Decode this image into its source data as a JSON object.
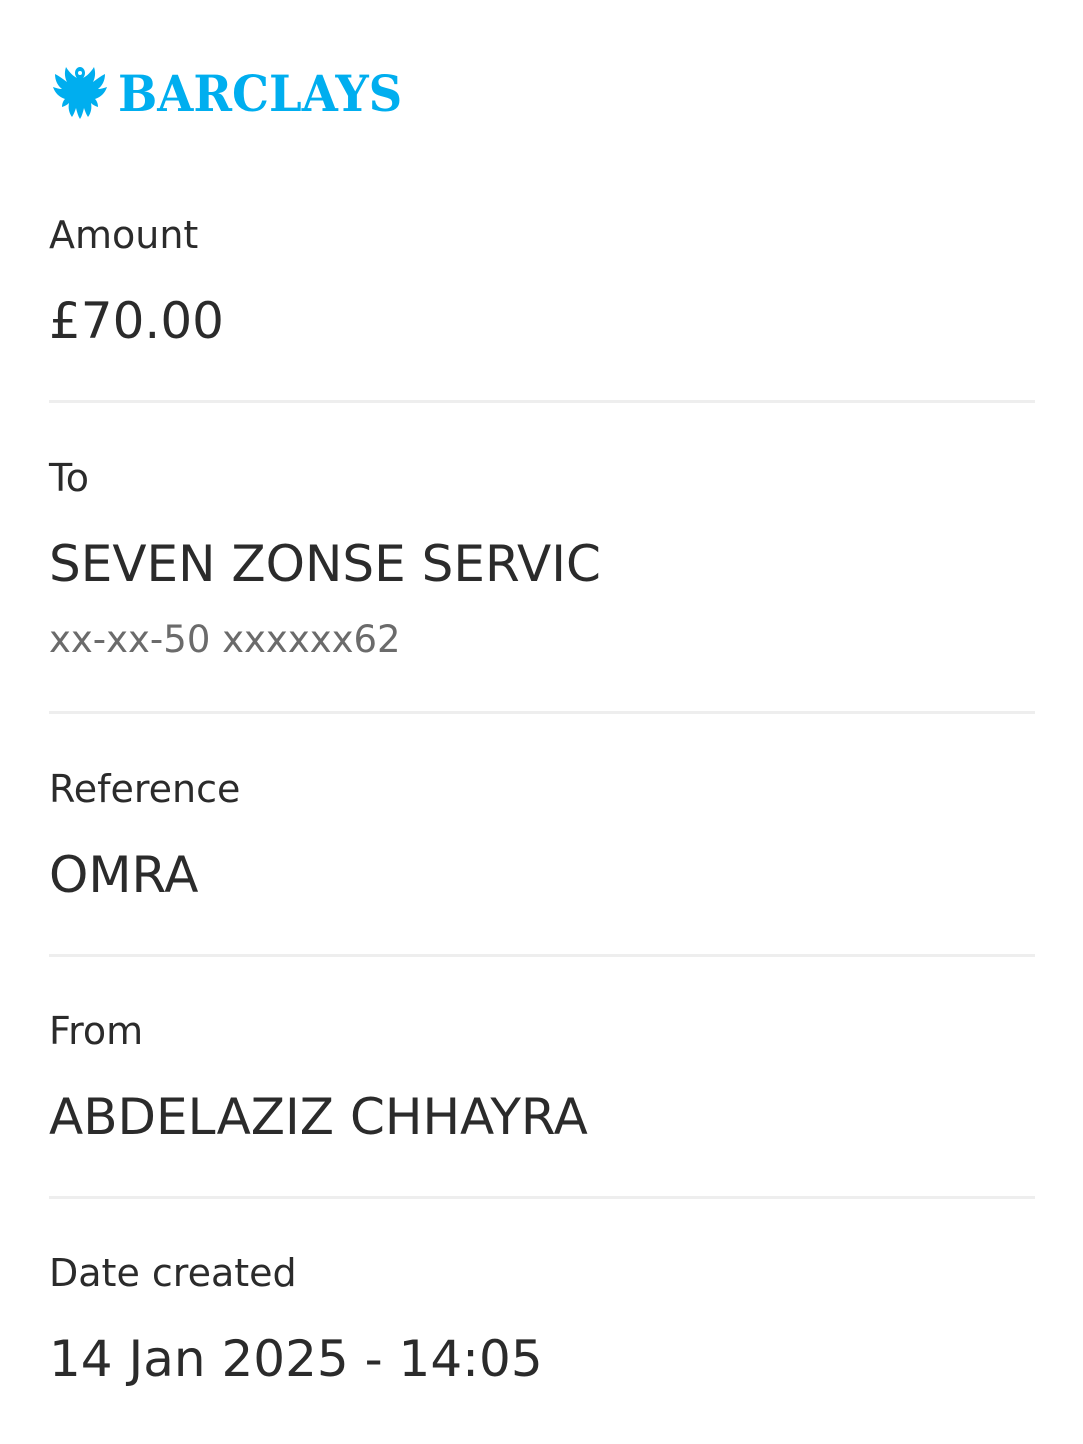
{
  "brand": {
    "name": "BARCLAYS",
    "color": "#00AEEF",
    "logo_icon": "eagle-icon"
  },
  "details": {
    "amount": {
      "label": "Amount",
      "value": "£70.00"
    },
    "to": {
      "label": "To",
      "value": "SEVEN ZONSE SERVIC",
      "account": "xx-xx-50 xxxxxx62"
    },
    "reference": {
      "label": "Reference",
      "value": "OMRA"
    },
    "from": {
      "label": "From",
      "value": "ABDELAZIZ CHHAYRA"
    },
    "date_created": {
      "label": "Date created",
      "value": "14 Jan 2025 - 14:05"
    }
  }
}
